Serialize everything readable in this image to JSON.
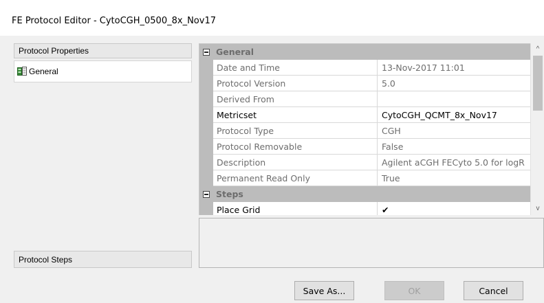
{
  "window": {
    "title": "FE Protocol Editor - CytoCGH_0500_8x_Nov17"
  },
  "left_pane": {
    "header": "Protocol Properties",
    "items": [
      {
        "label": "General",
        "icon": "protocol-checklist-icon"
      }
    ],
    "footer": "Protocol Steps"
  },
  "property_grid": {
    "categories": [
      {
        "label": "General",
        "properties": [
          {
            "name": "Date and Time",
            "value": "13-Nov-2017 11:01"
          },
          {
            "name": "Protocol Version",
            "value": "5.0"
          },
          {
            "name": "Derived From",
            "value": ""
          },
          {
            "name": "Metricset",
            "value": "CytoCGH_QCMT_8x_Nov17"
          },
          {
            "name": "Protocol Type",
            "value": "CGH"
          },
          {
            "name": "Protocol Removable",
            "value": "False"
          },
          {
            "name": "Description",
            "value": "Agilent aCGH FECyto 5.0 for logR"
          },
          {
            "name": "Permanent Read Only",
            "value": "True"
          }
        ]
      },
      {
        "label": "Steps",
        "properties": [
          {
            "name": "Place Grid",
            "value": "✔"
          }
        ]
      }
    ]
  },
  "buttons": {
    "save_as": "Save As...",
    "ok": "OK",
    "cancel": "Cancel"
  },
  "scrollbar": {
    "up": "^",
    "down": "v"
  }
}
